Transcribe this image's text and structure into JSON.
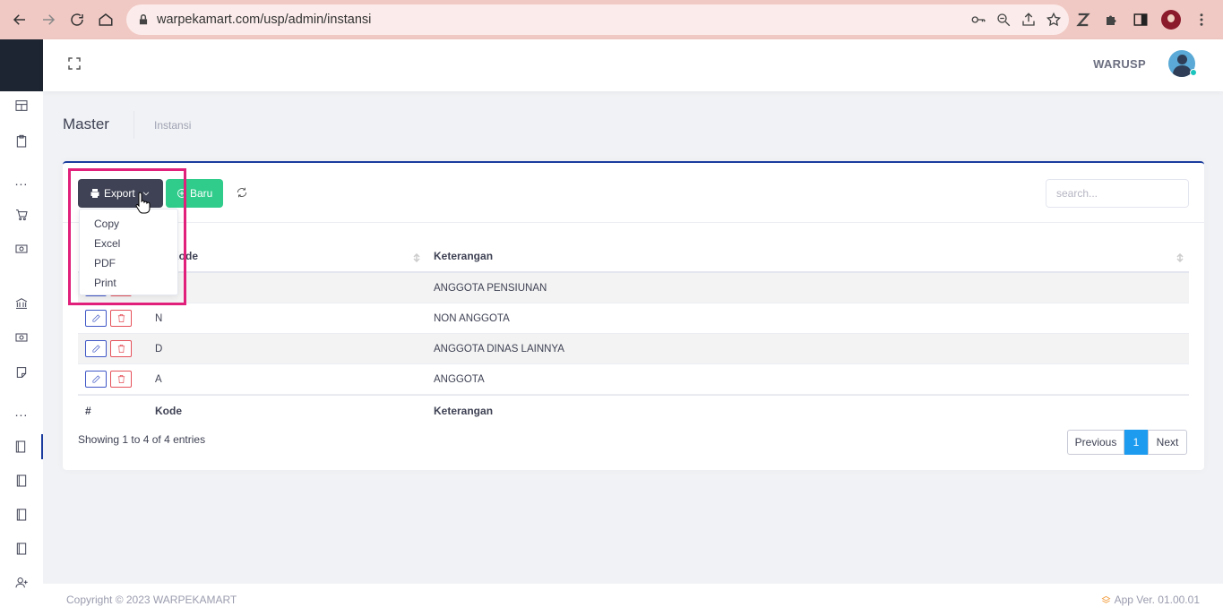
{
  "browser": {
    "url": "warpekamart.com/usp/admin/instansi"
  },
  "header": {
    "user_name": "WARUSP"
  },
  "subheader": {
    "title": "Master",
    "breadcrumb": "Instansi"
  },
  "toolbar": {
    "export_label": "Export",
    "new_label": "Baru",
    "search_placeholder": "search..."
  },
  "export_menu": [
    "Copy",
    "Excel",
    "PDF",
    "Print"
  ],
  "table": {
    "headers": {
      "num": "#",
      "kode": "Kode",
      "keterangan": "Keterangan"
    },
    "header_kode_partial": "e",
    "rows": [
      {
        "kode": "",
        "keterangan": "ANGGOTA PENSIUNAN"
      },
      {
        "kode": "N",
        "keterangan": "NON ANGGOTA"
      },
      {
        "kode": "D",
        "keterangan": "ANGGOTA DINAS LAINNYA"
      },
      {
        "kode": "A",
        "keterangan": "ANGGOTA"
      }
    ],
    "footer": {
      "num": "#",
      "kode": "Kode",
      "keterangan": "Keterangan"
    }
  },
  "info": "Showing 1 to 4 of 4 entries",
  "pagination": {
    "previous": "Previous",
    "current": "1",
    "next": "Next"
  },
  "footer": {
    "copyright": "Copyright © 2023 WARPEKAMART",
    "version": "App Ver. 01.00.01"
  },
  "colors": {
    "primary": "#1b3c9e",
    "export_btn": "#3f4254",
    "new_btn": "#2fcc8b",
    "pager_active": "#1c9bef",
    "highlight": "#e0207a"
  }
}
